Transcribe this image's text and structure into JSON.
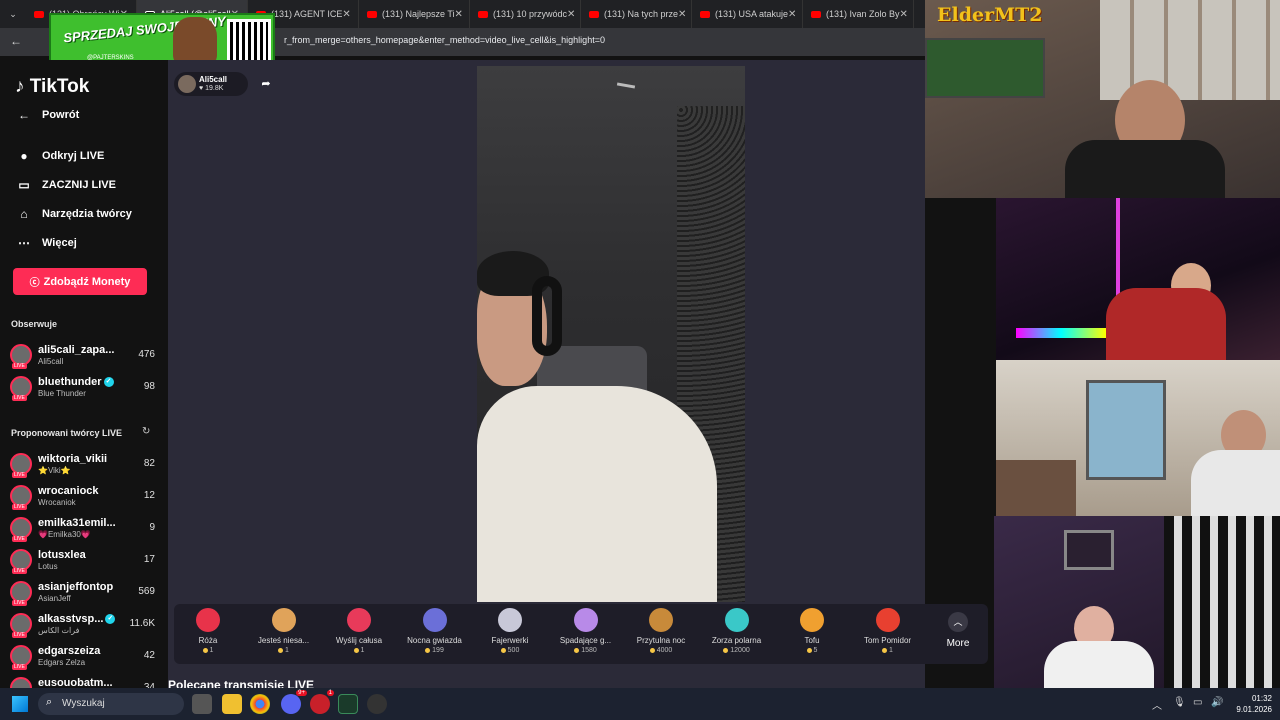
{
  "browser": {
    "tabs": [
      {
        "label": "(131) Obrońcy Wi",
        "active": false
      },
      {
        "label": "Ali5call (@ali5call",
        "active": true
      },
      {
        "label": "(131) AGENT ICE",
        "active": false
      },
      {
        "label": "(131) Najlepsze Ti",
        "active": false
      },
      {
        "label": "(131) 10 przywódc",
        "active": false
      },
      {
        "label": "(131) Na tych prze",
        "active": false
      },
      {
        "label": "(131) USA atakuje",
        "active": false
      },
      {
        "label": "(131) Ivan Zolo By",
        "active": false
      }
    ],
    "url": "r_from_merge=others_homepage&enter_method=video_live_cell&is_highlight=0"
  },
  "promo": {
    "text": "SPRZEDAJ SWOJE SKINY",
    "sub": "@PAJTERSKINS"
  },
  "sidebar": {
    "logo": "TikTok",
    "nav": [
      {
        "label": "Powrót",
        "icon": "back-arrow-icon"
      },
      {
        "label": "Odkryj LIVE",
        "icon": "live-avatar-icon"
      },
      {
        "label": "ZACZNIJ LIVE",
        "icon": "camera-icon"
      },
      {
        "label": "Narzędzia twórcy",
        "icon": "home-icon"
      },
      {
        "label": "Więcej",
        "icon": "more-dots-icon"
      }
    ],
    "coins_button": "Zdobądź Monety",
    "following_title": "Obserwuje",
    "following": [
      {
        "name": "ali5cali_zapa...",
        "sub": "Ali5call",
        "count": "476",
        "verified": false
      },
      {
        "name": "bluethunder",
        "sub": "Blue  Thunder",
        "count": "98",
        "verified": true
      }
    ],
    "suggested_title": "Proponowani twórcy LIVE",
    "suggested": [
      {
        "name": "wiktoria_vikii",
        "sub": "⭐Viki⭐",
        "count": "82",
        "verified": false
      },
      {
        "name": "wrocaniock",
        "sub": "Wrocaniok",
        "count": "12",
        "verified": false
      },
      {
        "name": "emilka31emil...",
        "sub": "💗Emilka30💗",
        "count": "9",
        "verified": false
      },
      {
        "name": "lotusxlea",
        "sub": "Lotus",
        "count": "17",
        "verified": false
      },
      {
        "name": "asianjeffontop",
        "sub": "AsianJeff",
        "count": "569",
        "verified": false
      },
      {
        "name": "alkasstvsp...",
        "sub": "فرات الكاس",
        "count": "11.6K",
        "verified": true
      },
      {
        "name": "edgarszeiza",
        "sub": "Edgars Zelza",
        "count": "42",
        "verified": false
      },
      {
        "name": "eusouobatm...",
        "sub": "",
        "count": "34",
        "verified": false
      }
    ]
  },
  "stream": {
    "name": "Ali5call",
    "likes": "19.8K"
  },
  "gifts": [
    {
      "name": "Róża",
      "price": "1",
      "color": "#e8334a"
    },
    {
      "name": "Jesteś niesa...",
      "price": "1",
      "color": "#e0a35a"
    },
    {
      "name": "Wyślij całusa",
      "price": "1",
      "color": "#e83a5a"
    },
    {
      "name": "Nocna gwiazda",
      "price": "199",
      "color": "#6b6fd8"
    },
    {
      "name": "Fajerwerki",
      "price": "500",
      "color": "#c8c8d8"
    },
    {
      "name": "Spadające g...",
      "price": "1580",
      "color": "#b88ae8"
    },
    {
      "name": "Przytulna noc",
      "price": "4000",
      "color": "#c88a3a"
    },
    {
      "name": "Zorza polarna",
      "price": "12000",
      "color": "#3ac8c8"
    },
    {
      "name": "Tofu",
      "price": "5",
      "color": "#f0a030"
    },
    {
      "name": "Tom Pomidor",
      "price": "1",
      "color": "#e84030"
    }
  ],
  "more_label": "More",
  "recommended_title": "Polecane transmisje LIVE",
  "overlay": {
    "cam_name": "ElderMT2"
  },
  "taskbar": {
    "search_label": "Wyszukaj",
    "time": "01:32",
    "date": "9.01.2026",
    "discord_badge": "9+",
    "app_badge": "1"
  }
}
